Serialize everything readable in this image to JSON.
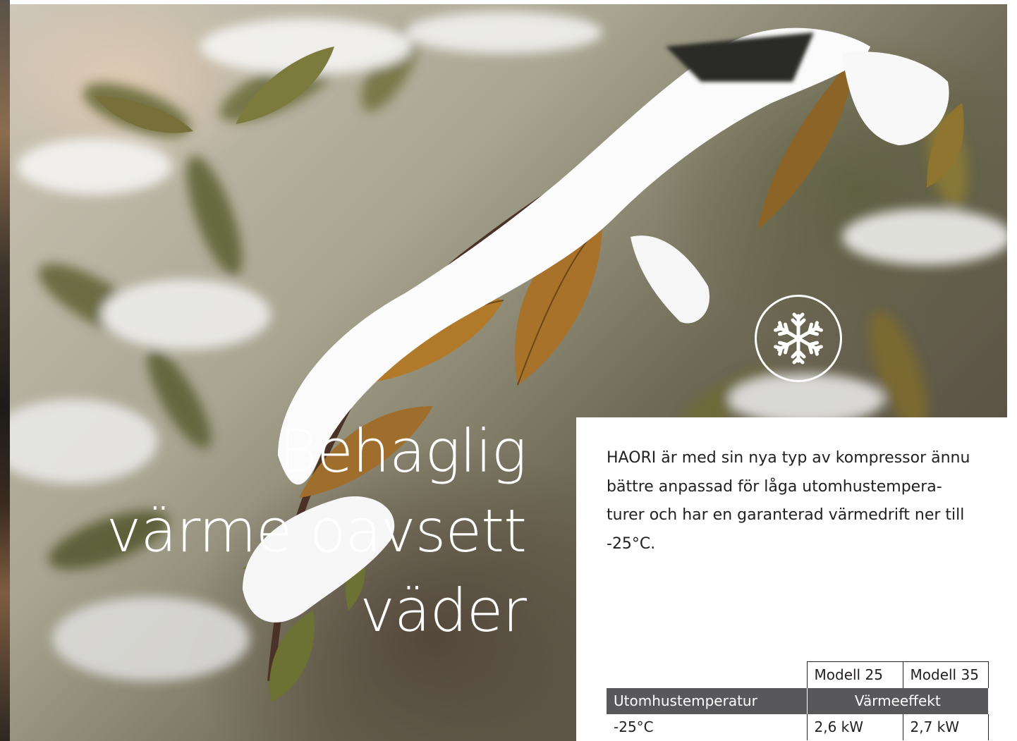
{
  "headline": {
    "lines": [
      "Behaglig",
      "värme oavsett",
      "väder"
    ]
  },
  "badge": {
    "icon": "snowflake-icon"
  },
  "body_text": "HAORI är med sin nya typ av kompressor ännu\nbättre anpassad för låga utomhustempera-\nturer och har en garanterad värmedrift ner till\n-25°C.",
  "table": {
    "models": [
      "Modell 25",
      "Modell 35"
    ],
    "header_label": "Utomhustemperatur",
    "header_group": "Värmeeffekt",
    "rows": [
      {
        "temp": "-25°C",
        "values": [
          "2,6 kW",
          "2,7 kW"
        ]
      }
    ]
  },
  "colors": {
    "table_header_bg": "#58585a",
    "text": "#231f20"
  }
}
